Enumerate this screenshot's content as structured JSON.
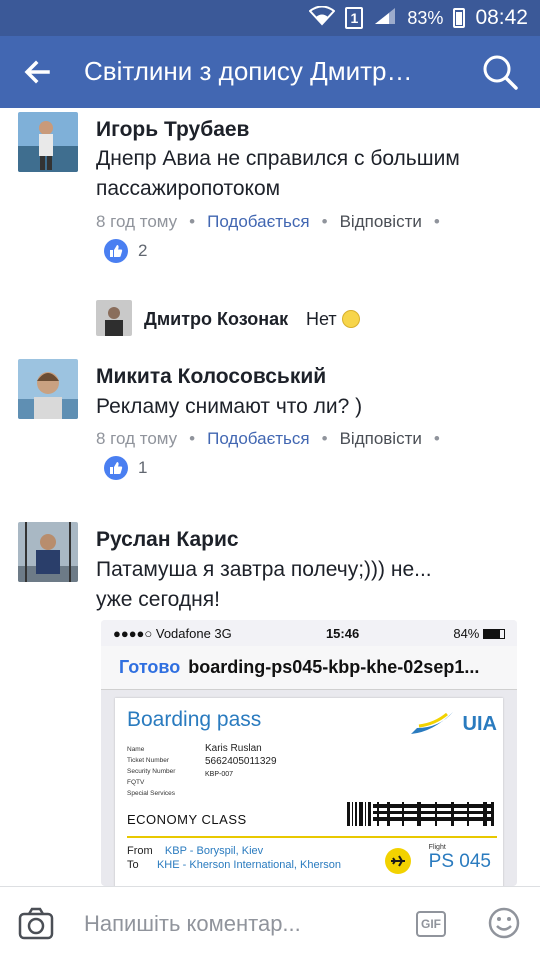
{
  "status_bar": {
    "sim_slot": "1",
    "battery_percent": "83%",
    "time": "08:42"
  },
  "app_bar": {
    "title": "Світлини з допису Дмитр…"
  },
  "comments": [
    {
      "author": "Игорь Трубаев",
      "lines": [
        "Днепр Авиа не справился с большим",
        "пассажиропотоком"
      ],
      "time": "8 год тому",
      "like_label": "Подобається",
      "reply_label": "Відповісти",
      "like_count": "2"
    },
    {
      "author": "Микита Колосовський",
      "lines": [
        "Рекламу снимают что ли? )"
      ],
      "time": "8 год тому",
      "like_label": "Подобається",
      "reply_label": "Відповісти",
      "like_count": "1"
    },
    {
      "author": "Руслан Карис",
      "lines": [
        "Патамуша я завтра полечу;))) не...",
        "уже сегодня!"
      ]
    }
  ],
  "reply": {
    "author": "Дмитро Козонак",
    "text": "Нет"
  },
  "attached_screenshot": {
    "carrier": "●●●●○ Vodafone  3G",
    "time": "15:46",
    "battery": "84%",
    "done": "Готово",
    "filename": "boarding-ps045-kbp-khe-02sep1...",
    "pass": {
      "title": "Boarding pass",
      "airline": "UIA",
      "labels": [
        "Name",
        "Ticket Number",
        "Security Number",
        "FQTV",
        "Special Services"
      ],
      "name": "Karis Ruslan",
      "ticket": "5662405011329",
      "security": "KBP-007",
      "class": "ECONOMY CLASS",
      "from_label": "From",
      "to_label": "To",
      "from": "KBP - Boryspil, Kiev",
      "to": "KHE - Kherson International, Kherson",
      "flight_label": "Flight",
      "flight": "PS 045"
    }
  },
  "composer": {
    "placeholder": "Напишіть коментар...",
    "gif": "GIF"
  }
}
